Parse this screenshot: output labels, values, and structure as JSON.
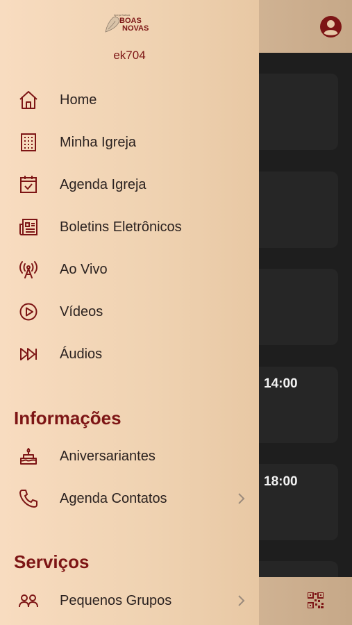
{
  "drawer": {
    "logo": {
      "small": "Igreja Batista",
      "line1": "BOAS",
      "line2": "NOVAS"
    },
    "user": "ek704",
    "items": [
      {
        "label": "Home",
        "icon": "home-icon"
      },
      {
        "label": "Minha Igreja",
        "icon": "building-icon"
      },
      {
        "label": "Agenda Igreja",
        "icon": "calendar-check-icon"
      },
      {
        "label": "Boletins Eletrônicos",
        "icon": "newspaper-icon"
      },
      {
        "label": "Ao Vivo",
        "icon": "broadcast-icon"
      },
      {
        "label": "Vídeos",
        "icon": "play-circle-icon"
      },
      {
        "label": "Áudios",
        "icon": "fast-forward-icon"
      }
    ],
    "sections": {
      "informacoes": {
        "title": "Informações",
        "items": [
          {
            "label": "Aniversariantes",
            "icon": "cake-icon"
          },
          {
            "label": "Agenda Contatos",
            "icon": "phone-icon"
          }
        ]
      },
      "servicos": {
        "title": "Serviços",
        "items": [
          {
            "label": "Pequenos Grupos",
            "icon": "group-icon"
          }
        ]
      }
    }
  },
  "background": {
    "times": [
      "14:00",
      "18:00"
    ]
  },
  "colors": {
    "accent": "#7d1515",
    "drawer_start": "#f8dcc0",
    "drawer_end": "#e8c8a4",
    "dark_bg": "#1e1e1e",
    "card": "#262626"
  }
}
